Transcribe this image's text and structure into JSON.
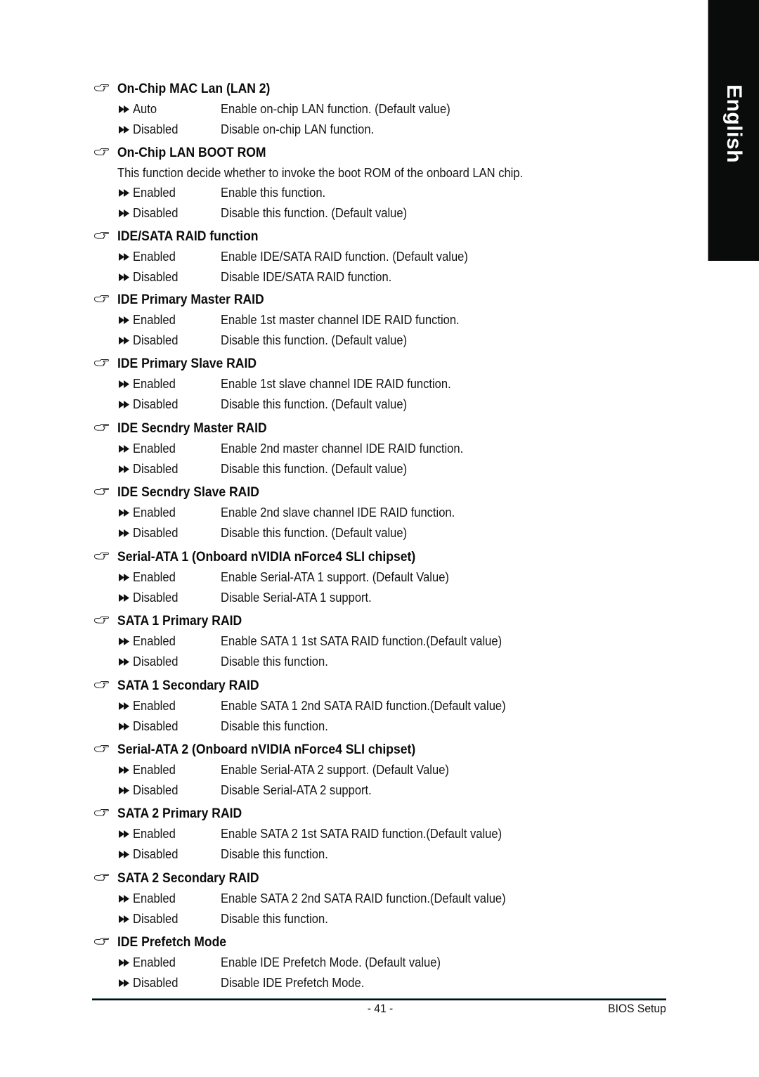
{
  "language_tab": {
    "label": "English"
  },
  "icons": {
    "heading_marker": "pointing-hand-icon",
    "option_bullet": "double-triangle-bullet-icon"
  },
  "sections": [
    {
      "title": "On-Chip MAC Lan (LAN 2)",
      "description": null,
      "options": [
        {
          "value": "Auto",
          "description": "Enable on-chip LAN function. (Default value)"
        },
        {
          "value": "Disabled",
          "description": "Disable on-chip LAN function."
        }
      ]
    },
    {
      "title": "On-Chip LAN BOOT ROM",
      "description": "This function decide whether to invoke the boot ROM of the onboard LAN chip.",
      "options": [
        {
          "value": "Enabled",
          "description": "Enable this function."
        },
        {
          "value": "Disabled",
          "description": "Disable this function. (Default value)"
        }
      ]
    },
    {
      "title": "IDE/SATA RAID function",
      "description": null,
      "options": [
        {
          "value": "Enabled",
          "description": "Enable IDE/SATA RAID function. (Default value)"
        },
        {
          "value": "Disabled",
          "description": "Disable IDE/SATA RAID function."
        }
      ]
    },
    {
      "title": "IDE Primary Master RAID",
      "description": null,
      "options": [
        {
          "value": "Enabled",
          "description": "Enable 1st master channel IDE RAID function."
        },
        {
          "value": "Disabled",
          "description": "Disable this function. (Default value)"
        }
      ]
    },
    {
      "title": "IDE Primary Slave RAID",
      "description": null,
      "options": [
        {
          "value": "Enabled",
          "description": "Enable 1st slave channel IDE RAID function."
        },
        {
          "value": "Disabled",
          "description": "Disable this function. (Default value)"
        }
      ]
    },
    {
      "title": "IDE Secndry Master RAID",
      "description": null,
      "options": [
        {
          "value": "Enabled",
          "description": "Enable 2nd master channel IDE RAID function."
        },
        {
          "value": "Disabled",
          "description": "Disable this function. (Default value)"
        }
      ]
    },
    {
      "title": "IDE Secndry Slave RAID",
      "description": null,
      "options": [
        {
          "value": "Enabled",
          "description": "Enable 2nd slave channel IDE RAID function."
        },
        {
          "value": "Disabled",
          "description": "Disable this function. (Default value)"
        }
      ]
    },
    {
      "title": "Serial-ATA 1 (Onboard nVIDIA nForce4 SLI chipset)",
      "description": null,
      "options": [
        {
          "value": "Enabled",
          "description": "Enable Serial-ATA 1 support. (Default Value)"
        },
        {
          "value": "Disabled",
          "description": "Disable Serial-ATA 1 support."
        }
      ]
    },
    {
      "title": "SATA 1 Primary RAID",
      "description": null,
      "options": [
        {
          "value": "Enabled",
          "description": "Enable SATA 1 1st SATA RAID function.(Default value)"
        },
        {
          "value": "Disabled",
          "description": "Disable this function."
        }
      ]
    },
    {
      "title": "SATA 1 Secondary RAID",
      "description": null,
      "options": [
        {
          "value": "Enabled",
          "description": "Enable SATA 1 2nd SATA RAID function.(Default value)"
        },
        {
          "value": "Disabled",
          "description": "Disable this function."
        }
      ]
    },
    {
      "title": "Serial-ATA 2  (Onboard nVIDIA nForce4 SLI chipset)",
      "description": null,
      "options": [
        {
          "value": "Enabled",
          "description": "Enable Serial-ATA 2 support. (Default Value)"
        },
        {
          "value": "Disabled",
          "description": "Disable Serial-ATA 2 support."
        }
      ]
    },
    {
      "title": "SATA 2 Primary RAID",
      "description": null,
      "options": [
        {
          "value": "Enabled",
          "description": "Enable SATA 2 1st SATA RAID function.(Default value)"
        },
        {
          "value": "Disabled",
          "description": "Disable this function."
        }
      ]
    },
    {
      "title": "SATA 2 Secondary RAID",
      "description": null,
      "options": [
        {
          "value": "Enabled",
          "description": "Enable SATA 2 2nd SATA RAID function.(Default value)"
        },
        {
          "value": "Disabled",
          "description": "Disable this function."
        }
      ]
    },
    {
      "title": "IDE Prefetch Mode",
      "description": null,
      "options": [
        {
          "value": "Enabled",
          "description": "Enable IDE Prefetch Mode. (Default value)"
        },
        {
          "value": "Disabled",
          "description": "Disable IDE Prefetch Mode."
        }
      ]
    }
  ],
  "footer": {
    "page_number": "- 41 -",
    "chapter": "BIOS Setup"
  }
}
